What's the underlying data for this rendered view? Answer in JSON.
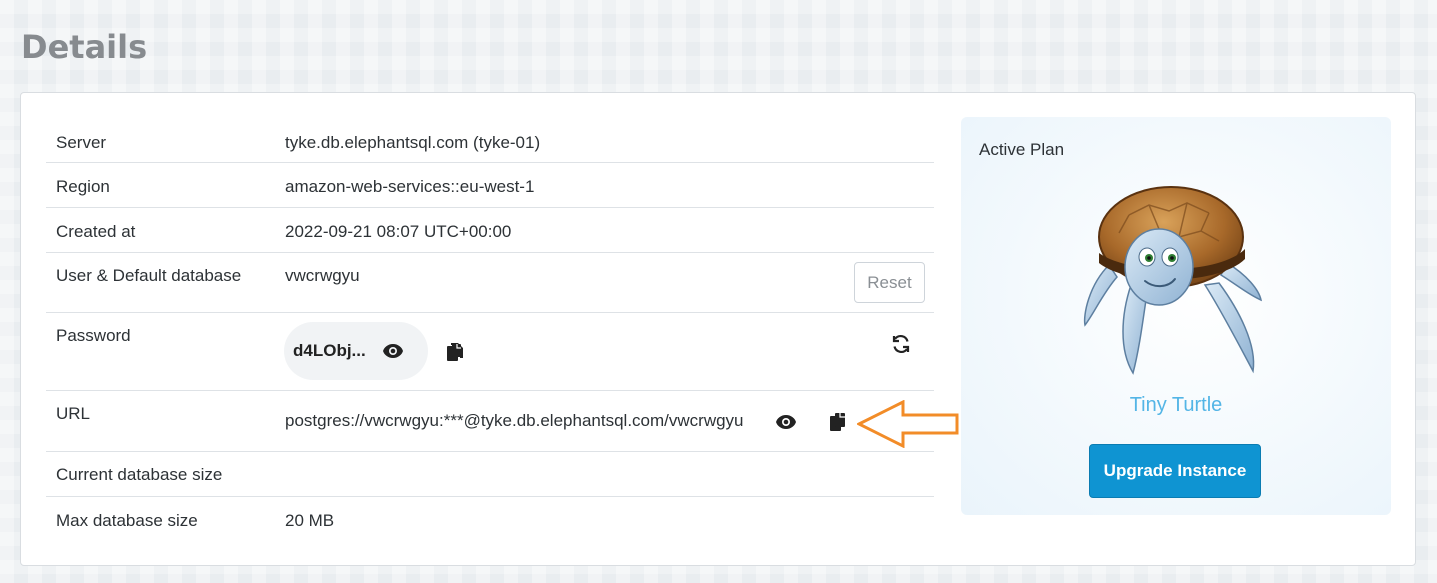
{
  "page": {
    "title": "Details"
  },
  "details": {
    "server": {
      "label": "Server",
      "value": "tyke.db.elephantsql.com (tyke-01)"
    },
    "region": {
      "label": "Region",
      "value": "amazon-web-services::eu-west-1"
    },
    "created_at": {
      "label": "Created at",
      "value": "2022-09-21 08:07 UTC+00:00"
    },
    "user": {
      "label": "User & Default database",
      "value": "vwcrwgyu",
      "reset_label": "Reset"
    },
    "password": {
      "label": "Password",
      "value": "d4LObj..."
    },
    "url": {
      "label": "URL",
      "value": "postgres://vwcrwgyu:***@tyke.db.elephantsql.com/vwcrwgyu"
    },
    "current_size": {
      "label": "Current database size",
      "value": ""
    },
    "max_size": {
      "label": "Max database size",
      "value": "20 MB"
    }
  },
  "plan": {
    "heading": "Active Plan",
    "name": "Tiny Turtle",
    "upgrade_label": "Upgrade Instance"
  },
  "icons": {
    "show_password": "eye-icon",
    "copy_password": "copy-icon",
    "rotate_password": "refresh-icon",
    "show_url": "eye-icon",
    "copy_url": "copy-icon",
    "annotation": "arrow-left-outline-icon",
    "mascot": "turtle-illustration"
  },
  "colors": {
    "accent": "#0f94d2",
    "plan_name": "#53b5e6",
    "annotation_arrow": "#f28c28"
  }
}
